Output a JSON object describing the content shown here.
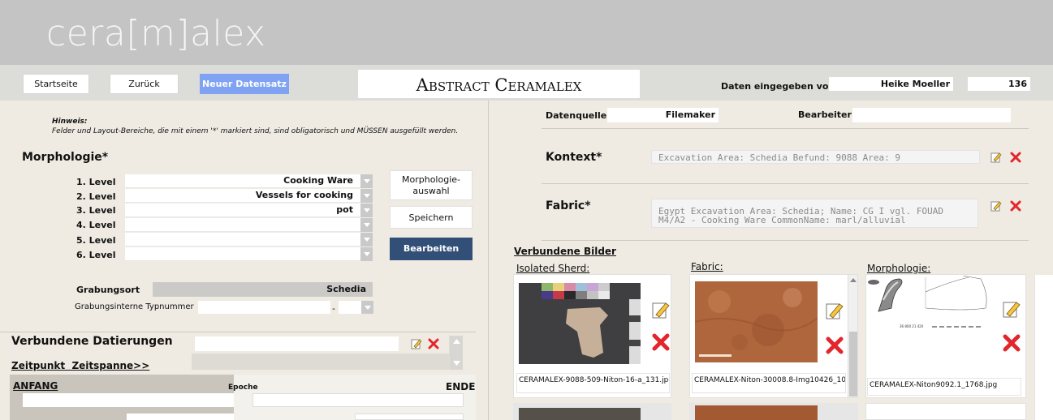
{
  "app": {
    "logo": "cera[m]alex"
  },
  "nav": {
    "startseite": "Startseite",
    "zurueck": "Zurück",
    "neuer": "Neuer Datensatz",
    "title": "Abstract Ceramalex",
    "daten_label": "Daten eingegeben von",
    "daten_user": "Heike Moeller",
    "record_no": "136"
  },
  "hint": {
    "title": "Hinweis:",
    "text": "Felder und Layout-Bereiche, die mit einem '*' markiert sind, sind obligatorisch und MÜSSEN ausgefüllt werden."
  },
  "morph": {
    "title": "Morphologie*",
    "levels": [
      {
        "label": "1. Level",
        "value": "Cooking Ware"
      },
      {
        "label": "2. Level",
        "value": "Vessels for cooking"
      },
      {
        "label": "3. Level",
        "value": "pot"
      },
      {
        "label": "4. Level",
        "value": ""
      },
      {
        "label": "5. Level",
        "value": ""
      },
      {
        "label": "6. Level",
        "value": ""
      }
    ],
    "btn_auswahl": "Morphologie-auswahl",
    "btn_speichern": "Speichern",
    "btn_bearbeiten": "Bearbeiten"
  },
  "grab": {
    "ort_label": "Grabungsort",
    "ort_value": "Schedia",
    "typ_label": "Grabungsinterne Typnummer",
    "typ_dash": "-"
  },
  "dat": {
    "title": "Verbundene Datierungen",
    "link": "Zeitpunkt  Zeitspanne>>",
    "anfang": "ANFANG",
    "epoche": "Epoche",
    "ende": "ENDE"
  },
  "right": {
    "quelle_label": "Datenquelle",
    "quelle_value": "Filemaker",
    "bearbeiter_label": "Bearbeiter",
    "kontext_label": "Kontext*",
    "kontext_value": "Excavation Area: Schedia Befund: 9088 Area: 9",
    "fabric_label": "Fabric*",
    "fabric_value": "Egypt Excavation Area: Schedia; Name: CG I vgl. FOUAD M4/A2 - Cooking Ware CommonName: marl/alluvial",
    "bilder_title": "Verbundene Bilder"
  },
  "images": [
    {
      "heading": "Isolated Sherd:",
      "file": "CERAMALEX-9088-509-Niton-16-a_131.jpg"
    },
    {
      "heading": "Fabric:",
      "file": "CERAMALEX-Niton-30008.8-Img10426_10.jpg"
    },
    {
      "heading": "Morphologie:",
      "file": "CERAMALEX-Niton9092.1_1768.jpg"
    }
  ],
  "colors": {
    "header_bg": "#c4c4c4",
    "page_bg": "#efebe2",
    "accent_blue": "#7fa2f2",
    "dark_blue": "#324f78",
    "delete_red": "#e2262c"
  }
}
